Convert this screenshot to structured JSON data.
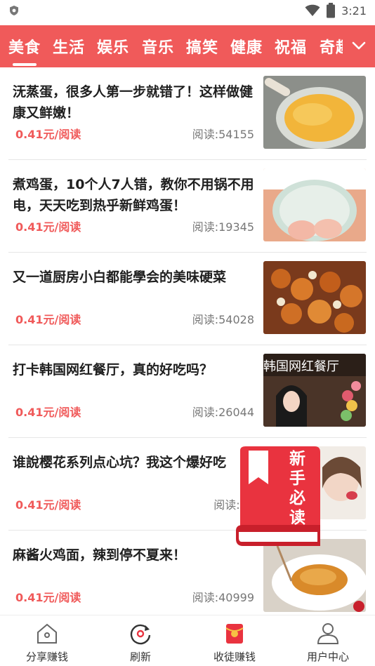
{
  "status_bar": {
    "time": "3:21",
    "icons": [
      "shield-icon",
      "wifi-icon",
      "battery-icon"
    ]
  },
  "tabs": {
    "items": [
      {
        "label": "美食",
        "active": true
      },
      {
        "label": "生活",
        "active": false
      },
      {
        "label": "娱乐",
        "active": false
      },
      {
        "label": "音乐",
        "active": false
      },
      {
        "label": "搞笑",
        "active": false
      },
      {
        "label": "健康",
        "active": false
      },
      {
        "label": "祝福",
        "active": false
      },
      {
        "label": "奇趣",
        "active": false
      }
    ],
    "more_icon": "chevron-down-icon",
    "colors": {
      "bar": "#f05a5a",
      "text": "#ffffff"
    }
  },
  "articles": [
    {
      "title": "𣲘蒸蛋，很多人第一步就错了！这样做健康又鲜嫩！",
      "price": "0.41元/阅读",
      "reads": "阅读:54155"
    },
    {
      "title": "煮鸡蛋，10个人7人错，教你不用锅不用电，天天吃到热乎新鲜鸡蛋！",
      "price": "0.41元/阅读",
      "reads": "阅读:19345"
    },
    {
      "title": "又一道厨房小白都能學会的美味硬菜",
      "price": "0.41元/阅读",
      "reads": "阅读:54028"
    },
    {
      "title": "打卡韩国网红餐厅，真的好吃吗？",
      "price": "0.41元/阅读",
      "reads": "阅读:26044",
      "thumb_text": "韩国网红餐厅"
    },
    {
      "title": "谁說樱花系列点心坑？我这个爆好吃",
      "price": "0.41元/阅读",
      "reads": "阅读:36"
    },
    {
      "title": "麻酱火鸡面，辣到停不夏来！",
      "price": "0.41元/阅读",
      "reads": "阅读:40999"
    }
  ],
  "floating_badge": {
    "text": "新手必读",
    "icon": "bookmark-book-icon"
  },
  "bottom_nav": [
    {
      "label": "分享赚钱",
      "icon": "share-house-icon"
    },
    {
      "label": "刷新",
      "icon": "refresh-icon"
    },
    {
      "label": "收徒赚钱",
      "icon": "red-envelope-icon"
    },
    {
      "label": "用户中心",
      "icon": "user-icon"
    }
  ],
  "colors": {
    "accent": "#f05a5a",
    "reads_text": "#777777"
  }
}
